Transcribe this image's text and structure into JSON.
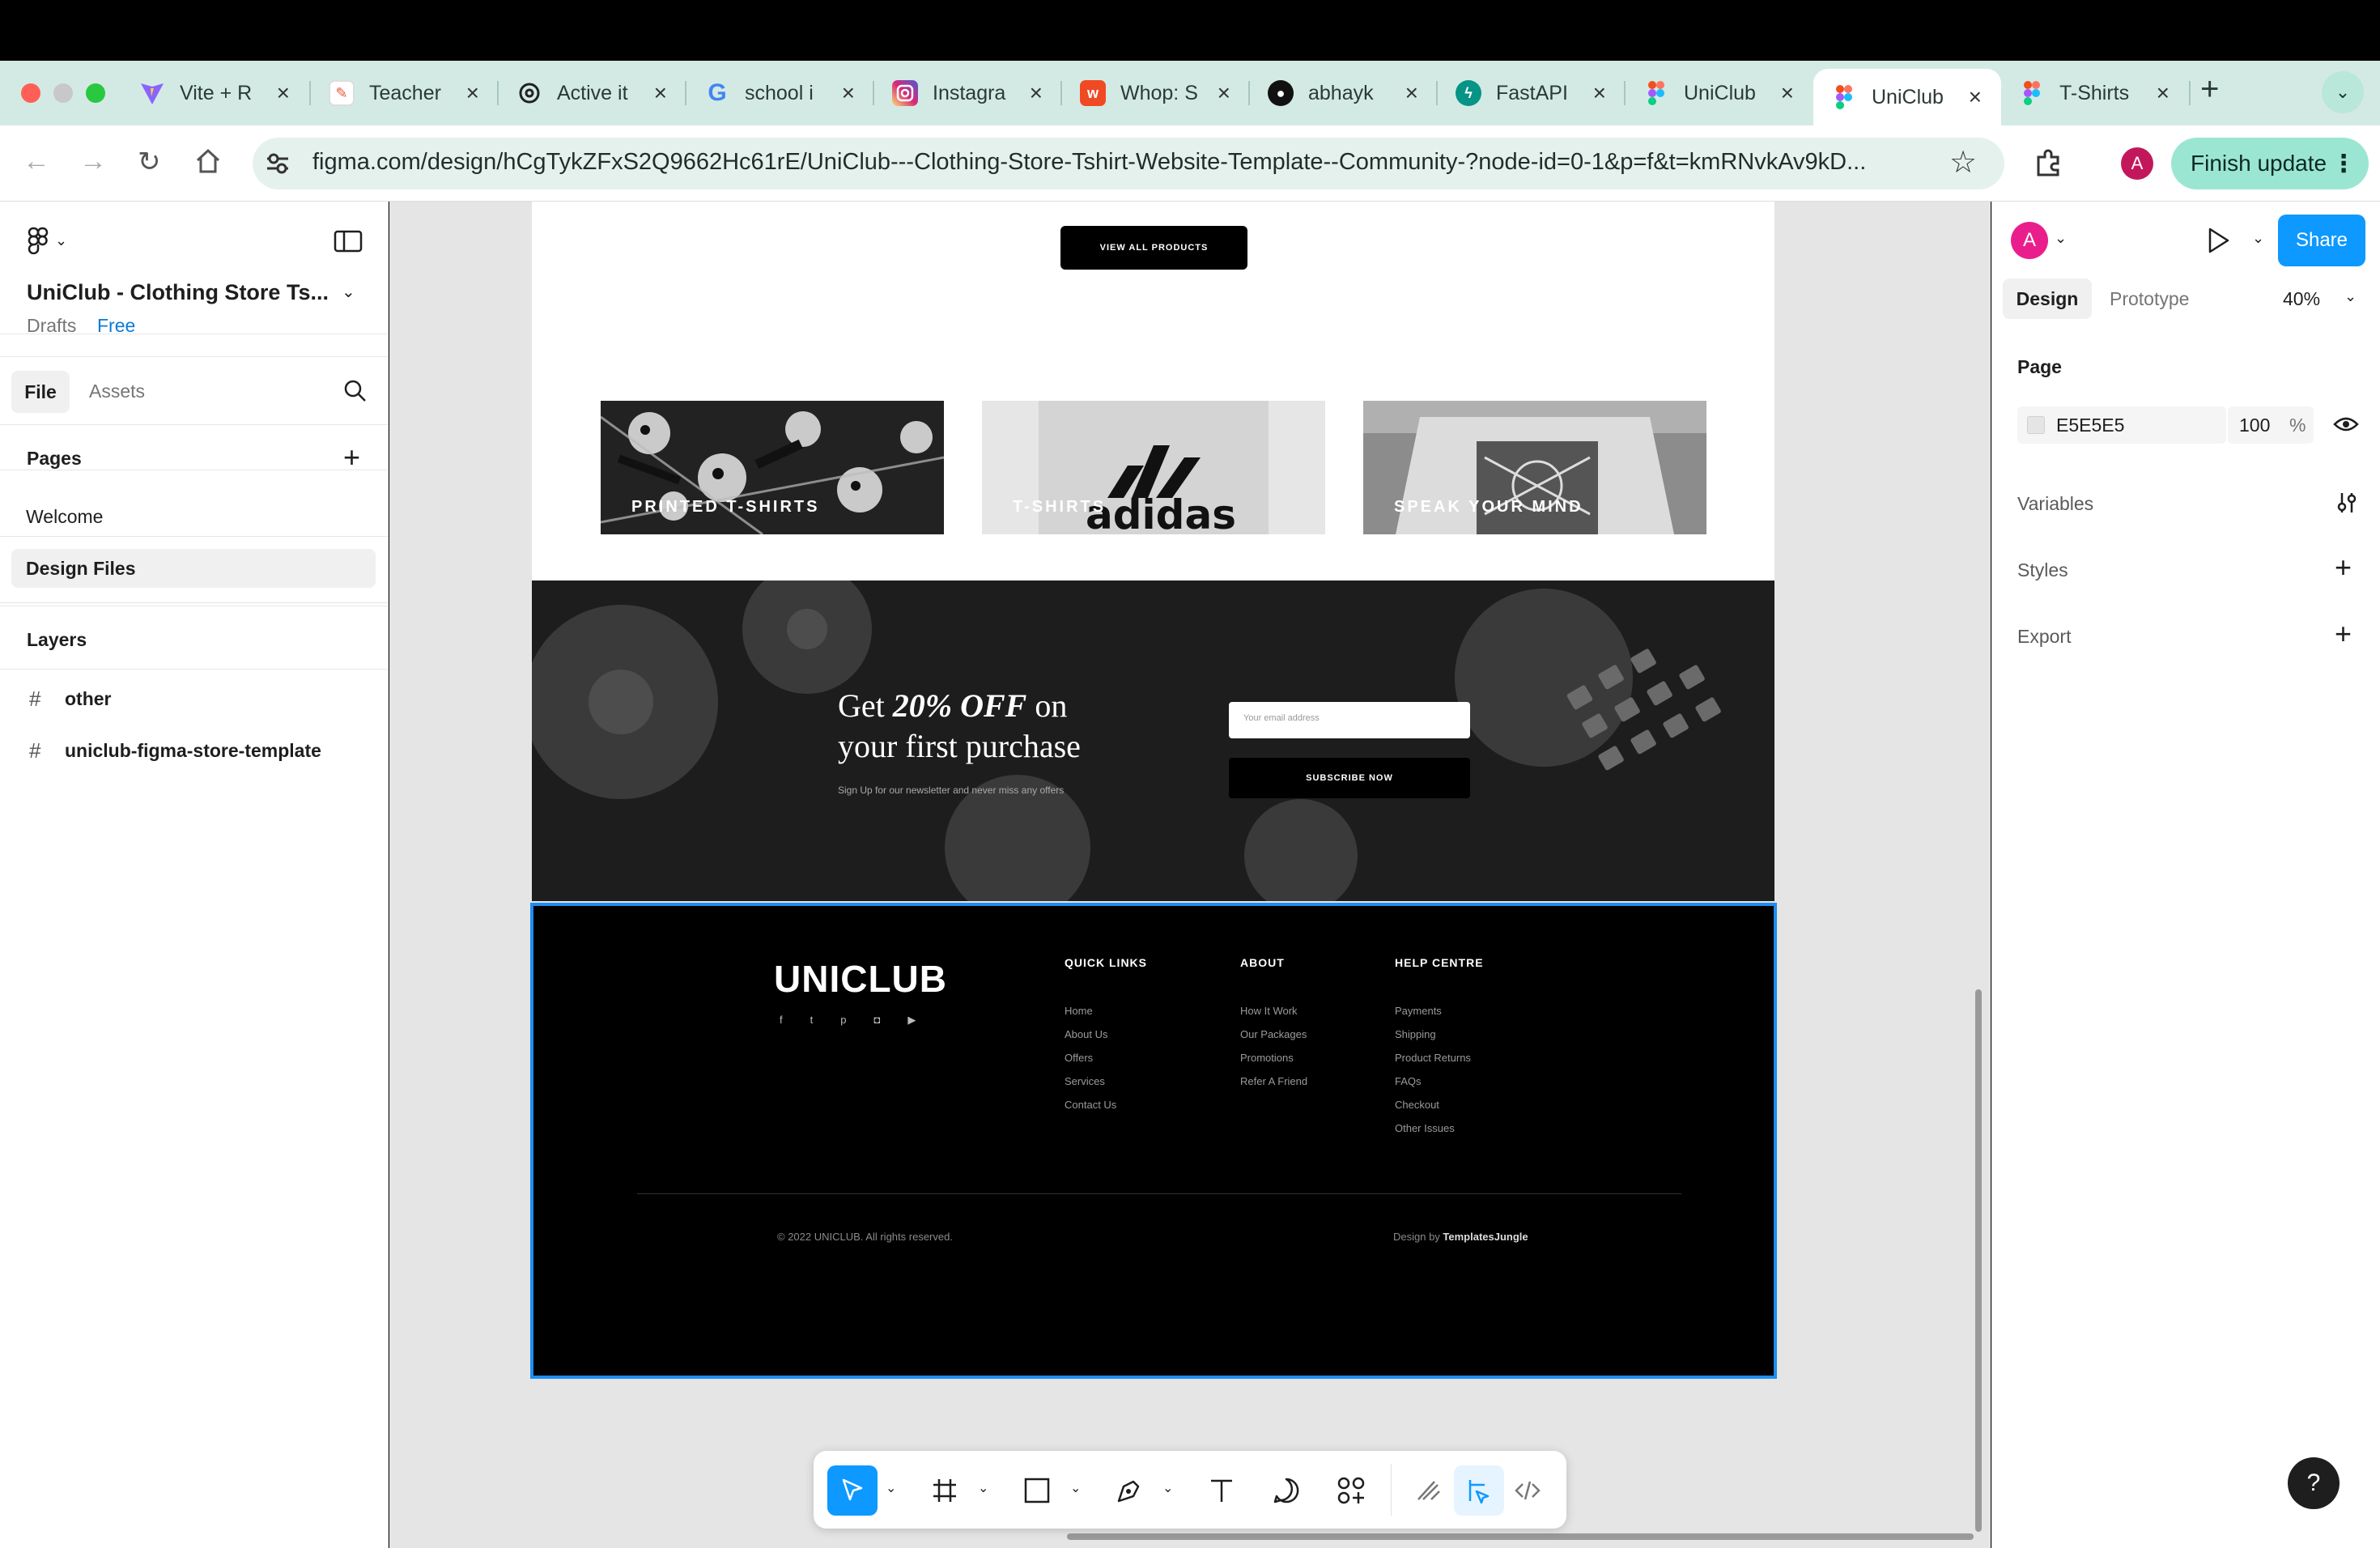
{
  "browser": {
    "tabs": [
      {
        "title": "Vite + R",
        "icon": "vite-icon",
        "color": "#7c5cff"
      },
      {
        "title": "Teacher",
        "icon": "pencil-icon",
        "color": "#e8543b"
      },
      {
        "title": "Active it",
        "icon": "openai-icon",
        "color": "#222222"
      },
      {
        "title": "school i",
        "icon": "google-icon",
        "color": "#4285f4"
      },
      {
        "title": "Instagra",
        "icon": "instagram-icon",
        "color": "#d6249f"
      },
      {
        "title": "Whop: S",
        "icon": "whop-icon",
        "color": "#f04a24"
      },
      {
        "title": "abhayk",
        "icon": "github-icon",
        "color": "#111111"
      },
      {
        "title": "FastAPI",
        "icon": "fastapi-icon",
        "color": "#059485"
      },
      {
        "title": "UniClub",
        "icon": "figma-icon",
        "color": "#f24e1e"
      },
      {
        "title": "UniClub",
        "icon": "figma-icon",
        "color": "#f24e1e"
      },
      {
        "title": "T-Shirts",
        "icon": "figma-icon",
        "color": "#f24e1e"
      }
    ],
    "new_tab": "+",
    "url": "figma.com/design/hCgTykZFxS2Q9662Hc61rE/UniClub---Clothing-Store-Tshirt-Website-Template--Community-?node-id=0-1&p=f&t=kmRNvkAv9kD...",
    "profile_initial": "A",
    "finish_update": "Finish update"
  },
  "figma": {
    "file_title": "UniClub - Clothing Store Ts...",
    "drafts": "Drafts",
    "plan": "Free",
    "tabs": {
      "file": "File",
      "assets": "Assets"
    },
    "pages_heading": "Pages",
    "pages": [
      "Welcome",
      "Design Files"
    ],
    "layers_heading": "Layers",
    "layers": [
      "other",
      "uniclub-figma-store-template"
    ],
    "right": {
      "avatar": "A",
      "share": "Share",
      "design_tab": "Design",
      "prototype_tab": "Prototype",
      "zoom": "40%",
      "page_heading": "Page",
      "bg_hex": "E5E5E5",
      "bg_opacity": "100",
      "percent": "%",
      "variables": "Variables",
      "styles": "Styles",
      "export": "Export"
    },
    "help": "?"
  },
  "design": {
    "view_all": "VIEW ALL PRODUCTS",
    "categories": [
      "PRINTED T-SHIRTS",
      "T-SHIRTS",
      "SPEAK YOUR MIND"
    ],
    "adidas_word": "adidas",
    "newsletter": {
      "line1_a": "Get ",
      "line1_b": "20% OFF",
      "line1_c": " on",
      "line2": "your first purchase",
      "sub": "Sign Up for our newsletter and never miss any offers",
      "email_placeholder": "Your email address",
      "button": "SUBSCRIBE NOW"
    },
    "footer": {
      "logo": "UNICLUB",
      "quick_links_heading": "QUICK LINKS",
      "quick_links": [
        "Home",
        "About Us",
        "Offers",
        "Services",
        "Contact Us"
      ],
      "about_heading": "ABOUT",
      "about_links": [
        "How It Work",
        "Our Packages",
        "Promotions",
        "Refer A Friend"
      ],
      "help_heading": "HELP CENTRE",
      "help_links": [
        "Payments",
        "Shipping",
        "Product Returns",
        "FAQs",
        "Checkout",
        "Other Issues"
      ],
      "copyright": "© 2022 UNICLUB. All rights reserved.",
      "design_by": "Design by ",
      "design_by_name": "TemplatesJungle"
    }
  },
  "colors": {
    "selection": "#1f8df0",
    "share_button": "#0d99ff",
    "canvas": "#e5e5e5",
    "finish_update": "#9be6d2"
  }
}
